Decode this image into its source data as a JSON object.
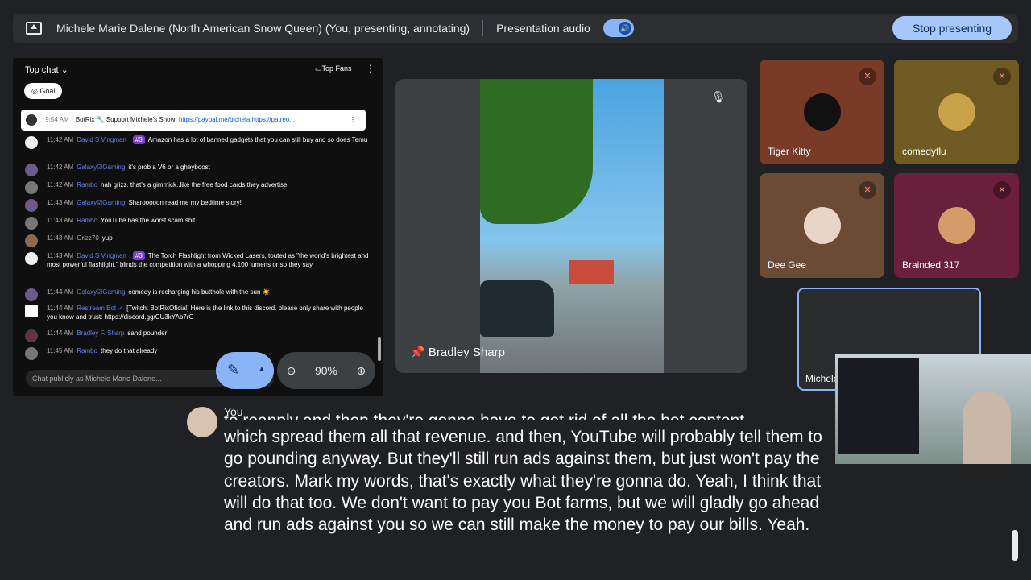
{
  "topbar": {
    "title": "Michele Marie Dalene (North American Snow Queen) (You, presenting, annotating)",
    "audio_label": "Presentation audio",
    "stop_label": "Stop presenting"
  },
  "chat": {
    "header": "Top chat",
    "top_fans": "Top Fans",
    "goal": "Goal",
    "pinned": {
      "time": "9:54 AM",
      "author": "BotRix",
      "text": "Support Michele's Show! ",
      "link1": "https://paypal.me/bichela",
      "link2": "https://patreo..."
    },
    "messages": [
      {
        "time": "11:42 AM",
        "author": "David S Vingman",
        "badge": "#3",
        "text": "Amazon has a lot of banned gadgets that you can still buy and so does Temu"
      },
      {
        "time": "11:42 AM",
        "author": "Galaxy☑Gaming",
        "badge": "",
        "text": "it's prob a V6 or a gheyboost"
      },
      {
        "time": "11:42 AM",
        "author": "Rambo",
        "badge": "",
        "text": "nah grizz. that's a gimmick..like the free food cards they advertise"
      },
      {
        "time": "11:43 AM",
        "author": "Galaxy☑Gaming",
        "badge": "",
        "text": "Sharooooon read me my bedtime story!"
      },
      {
        "time": "11:43 AM",
        "author": "Rambo",
        "badge": "",
        "text": "YouTube has the worst scam shit"
      },
      {
        "time": "11:43 AM",
        "author": "Grizz70",
        "badge": "",
        "text": "yup"
      },
      {
        "time": "11:43 AM",
        "author": "David S Vingman",
        "badge": "#3",
        "text": "The Torch Flashlight from Wicked Lasers, touted as \"the world's brightest and most powerful flashlight,\" blinds the competition with a whopping 4,100 lumens or so they say"
      },
      {
        "time": "11:44 AM",
        "author": "Galaxy☑Gaming",
        "badge": "",
        "text": "comedy is recharging his butthole with the sun ☀️"
      },
      {
        "time": "11:44 AM",
        "author": "Restream Bot ✓",
        "badge": "",
        "text": "[Twitch: BotRixOficial] Here is the link to this discord. please only share with people you know and trust: https://discord.gg/CU3kYAb7rG"
      },
      {
        "time": "11:44 AM",
        "author": "Bradley F. Sharp",
        "badge": "",
        "text": "sand pounder"
      },
      {
        "time": "11:45 AM",
        "author": "Rambo",
        "badge": "",
        "text": "they do that already"
      }
    ],
    "input_placeholder": "Chat publicly as Michele Marie Dalene..."
  },
  "zoom": {
    "level": "90%"
  },
  "main_tile": {
    "name": "Bradley Sharp"
  },
  "tiles": [
    {
      "name": "Tiger Kitty",
      "bg": "#7a3a28"
    },
    {
      "name": "comedyflu",
      "bg": "#6e5a22"
    },
    {
      "name": "Dee Gee",
      "bg": "#6b4a36"
    },
    {
      "name": "Brainded 317",
      "bg": "#6a1f3c"
    }
  ],
  "self_tile": {
    "name": "Michele"
  },
  "caption": {
    "speaker": "You",
    "partial": "to reapply and then they're gonna have to get rid of all the bot content,",
    "text": "which spread them all that revenue. and then, YouTube will probably tell them to go pounding anyway. But they'll still run ads against them, but just won't pay the creators. Mark my words, that's exactly what they're gonna do. Yeah, I think that will do that too. We don't want to pay you Bot farms, but we will gladly go ahead and run ads against you so we can still make the money to pay our bills. Yeah."
  }
}
